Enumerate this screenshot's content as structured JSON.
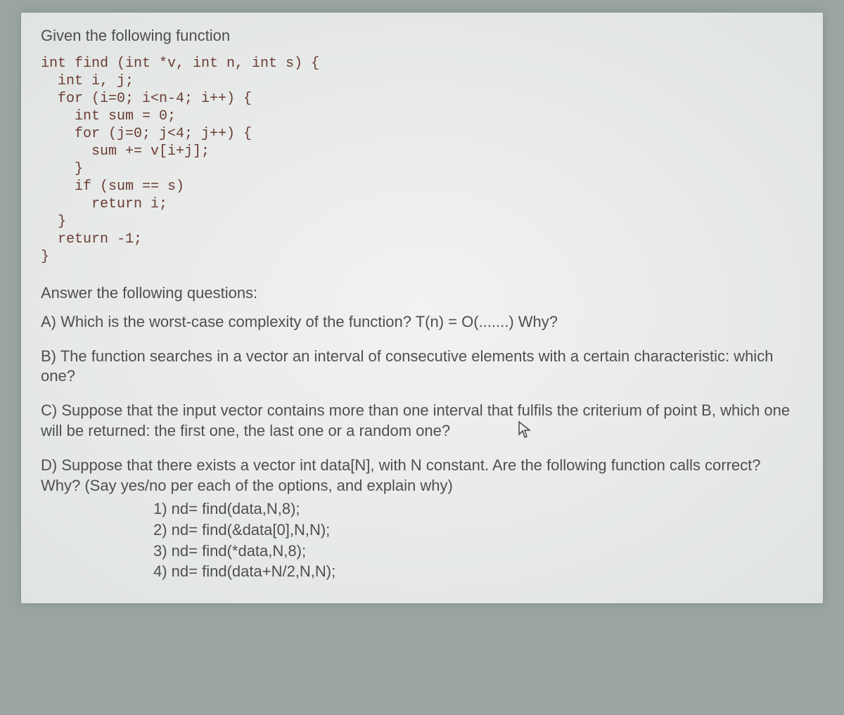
{
  "intro": "Given the following function",
  "code": {
    "l1": "int find (int *v, int n, int s) {",
    "l2": "  int i, j;",
    "l3": "  for (i=0; i<n-4; i++) {",
    "l4": "    int sum = 0;",
    "l5": "    for (j=0; j<4; j++) {",
    "l6": "      sum += v[i+j];",
    "l7": "    }",
    "l8": "    if (sum == s)",
    "l9": "      return i;",
    "l10": "  }",
    "l11": "  return -1;",
    "l12": "}"
  },
  "heading": "Answer the following questions:",
  "qA": "A) Which is the worst-case complexity of the function? T(n) = O(.......) Why?",
  "qB": "B) The function searches in a vector an interval of consecutive elements with a certain characteristic: which one?",
  "qC": "C) Suppose that the input vector contains more than one interval that fulfils the criterium of point B, which one will be returned: the first one, the last one or a random one?",
  "qD_intro": "D) Suppose that there exists a vector int data[N], with N constant. Are the following function calls correct? Why? (Say yes/no per each of the options, and explain why)",
  "calls": {
    "c1": "1) nd= find(data,N,8);",
    "c2": "2) nd= find(&data[0],N,N);",
    "c3": "3) nd= find(*data,N,8);",
    "c4": "4) nd= find(data+N/2,N,N);"
  }
}
